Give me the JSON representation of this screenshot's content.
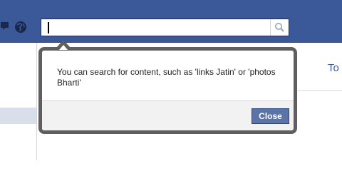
{
  "search": {
    "value": "",
    "placeholder": ""
  },
  "callout": {
    "message": "You can search for content, such as 'links Jatin' or 'photos Bharti'",
    "close_label": "Close"
  },
  "content": {
    "partial_link": "To"
  },
  "colors": {
    "topbar": "#3b5998",
    "close_button": "#5b74a8",
    "callout_border": "#5f5f5f"
  },
  "icons": {
    "topbar": [
      "messages-icon",
      "notifications-globe-icon"
    ],
    "search": "magnifier-icon"
  }
}
